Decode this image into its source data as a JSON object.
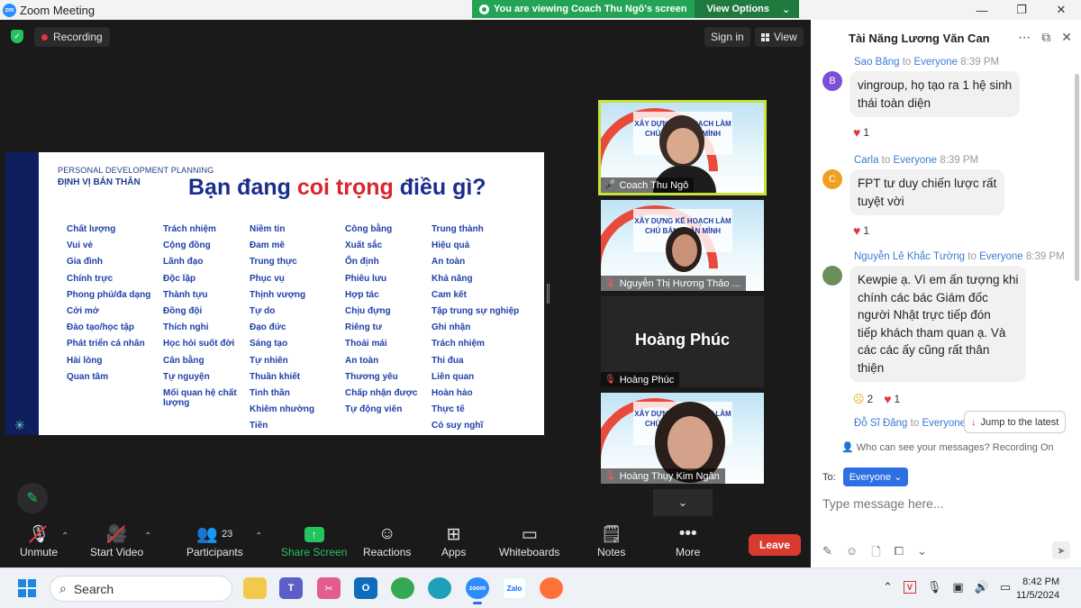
{
  "window": {
    "title": "Zoom Meeting",
    "logo_text": "zm",
    "viewing_banner": "You are viewing Coach Thu Ngô's screen",
    "view_options": "View Options"
  },
  "meeting": {
    "recording_label": "Recording",
    "sign_in": "Sign in",
    "view": "View"
  },
  "slide": {
    "kicker": "PERSONAL DEVELOPMENT PLANNING",
    "subtitle": "ĐỊNH VỊ BẢN THÂN",
    "heading_part1": "Bạn đang ",
    "heading_highlight": "coi trọng",
    "heading_part2": " điều gì?",
    "columns": [
      [
        "Chất lượng",
        "Vui vẻ",
        "Gia đình",
        "Chính trực",
        "Phong phú/đa dạng",
        "Cởi mở",
        "Đào tạo/học tập",
        "Phát triển cá nhân",
        "Hài lòng",
        "Quan tâm"
      ],
      [
        "Trách nhiệm",
        "Cộng đồng",
        "Lãnh đạo",
        "Độc lập",
        "Thành tựu",
        "Đồng đội",
        "Thích nghi",
        "Học hỏi suốt đời",
        "Cân bằng",
        "Tự nguyện",
        "Mối quan hệ chất lượng"
      ],
      [
        "Niềm tin",
        "Đam mê",
        "Trung thực",
        "Phục vụ",
        "Thịnh vượng",
        "Tự do",
        "Đạo đức",
        "Sáng tạo",
        "Tự nhiên",
        "Thuần khiết",
        "Tinh thần",
        "Khiêm nhường",
        "Tiền"
      ],
      [
        "Công bằng",
        "Xuất sắc",
        "Ổn định",
        "Phiêu lưu",
        "Hợp tác",
        "Chịu đựng",
        "Riêng tư",
        "Thoải mái",
        "An toàn",
        "Thương yêu",
        "Chấp nhận được",
        "Tự động viên"
      ],
      [
        "Trung thành",
        "Hiệu quả",
        "An toàn",
        "Khả năng",
        "Cam kết",
        "Tập trung sự nghiệp",
        "Ghi nhận",
        "Trách nhiệm",
        "Thi đua",
        "Liên quan",
        "Hoàn hảo",
        "Thực tế",
        "Có suy nghĩ"
      ]
    ]
  },
  "tiles": [
    {
      "name": "Coach Thu Ngô",
      "banner": "XÂY DỰNG KẾ HOẠCH LÀM CHỦ BẢN THÂN MÌNH"
    },
    {
      "name": "Nguyễn Thị Hương Thảo ...",
      "banner": "XÂY DỰNG KẾ HOẠCH LÀM CHỦ BẢN THÂN MÌNH"
    },
    {
      "name": "Hoàng Phúc",
      "avatar_name": "Hoàng Phúc"
    },
    {
      "name": "Hoàng Thụy Kim Ngân",
      "banner": "XÂY DỰNG KẾ HOẠCH LÀM CHỦ BẢN THÂN MÌNH"
    }
  ],
  "toolbar": {
    "unmute": "Unmute",
    "start_video": "Start Video",
    "participants": "Participants",
    "participants_count": "23",
    "share_screen": "Share Screen",
    "reactions": "Reactions",
    "apps": "Apps",
    "whiteboards": "Whiteboards",
    "notes": "Notes",
    "more": "More",
    "leave": "Leave"
  },
  "chat": {
    "title": "Tài Năng Lương Văn Can",
    "messages": [
      {
        "initial": "B",
        "avatar_color": "#7b4fd6",
        "sender": "Sao Băng",
        "to_word": " to ",
        "recipient": "Everyone",
        "time": "8:39 PM",
        "lines": [
          "vingroup, họ tạo ra 1 hệ sinh",
          "thái toàn diện"
        ],
        "react_heart": "1"
      },
      {
        "initial": "C",
        "avatar_color": "#f0a020",
        "sender": "Carla",
        "to_word": " to ",
        "recipient": "Everyone",
        "time": "8:39 PM",
        "lines": [
          "FPT tư duy chiến lược rất",
          "tuyệt vời"
        ],
        "react_heart": "1"
      },
      {
        "initial": "",
        "avatar_color": "#6a8f5a",
        "sender": "Nguyễn Lê Khắc Tường",
        "to_word": " to ",
        "recipient": "Everyone",
        "time": "8:39 PM",
        "lines": [
          "Kewpie ạ. Vì em ấn tượng khi",
          "chính các bác Giám đốc",
          "người Nhật trực tiếp đón",
          "tiếp khách tham quan ạ. Và",
          "các các ấy cũng rất thân",
          "thiện"
        ],
        "react_sad": "2",
        "react_heart": "1"
      },
      {
        "sender": "Đỗ Sĩ Đăng",
        "to_word": " to ",
        "recipient": "Everyone"
      }
    ],
    "jump_latest": "Jump to the latest",
    "who_can_see": "Who can see your messages? Recording On",
    "to_label": "To:",
    "to_value": "Everyone",
    "placeholder": "Type message here..."
  },
  "taskbar": {
    "search": "Search",
    "time": "8:42 PM",
    "date": "11/5/2024"
  },
  "colors": {
    "zoom_blue": "#2d8cff",
    "viewing_green": "#23a455",
    "leave_red": "#d93a2f",
    "share_green": "#23c35e",
    "slide_navy": "#1a2d8c",
    "slide_red": "#d7262c"
  }
}
